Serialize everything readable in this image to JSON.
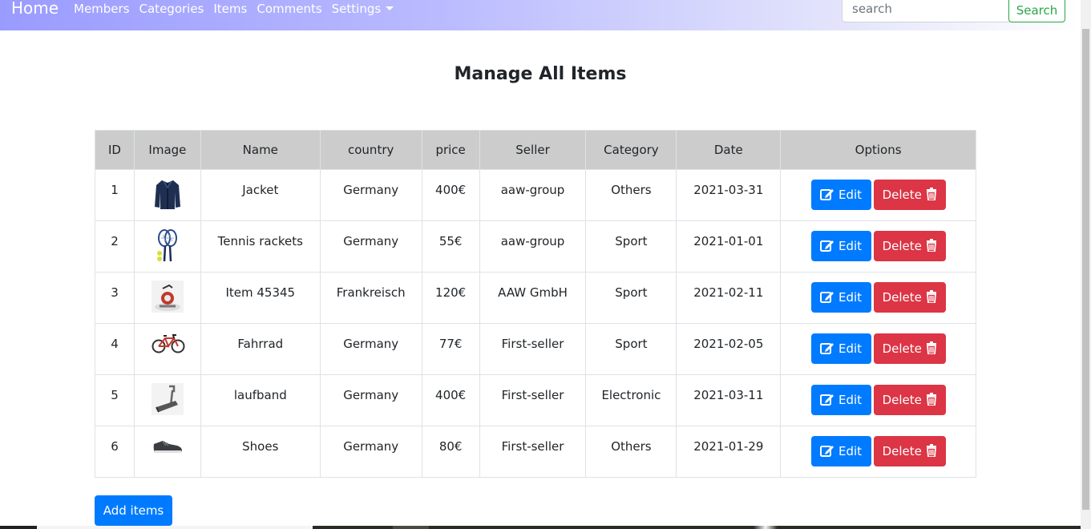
{
  "nav": {
    "brand": "Home",
    "links": [
      "Members",
      "Categories",
      "Items",
      "Comments",
      "Settings"
    ],
    "search_placeholder": "search",
    "search_button": "Search"
  },
  "page_title": "Manage All Items",
  "table": {
    "headers": [
      "ID",
      "Image",
      "Name",
      "country",
      "price",
      "Seller",
      "Category",
      "Date",
      "Options"
    ],
    "rows": [
      {
        "id": "1",
        "image": "jacket",
        "name": "Jacket",
        "country": "Germany",
        "price": "400€",
        "seller": "aaw-group",
        "category": "Others",
        "date": "2021-03-31"
      },
      {
        "id": "2",
        "image": "tennis-rackets",
        "name": "Tennis rackets",
        "country": "Germany",
        "price": "55€",
        "seller": "aaw-group",
        "category": "Sport",
        "date": "2021-01-01"
      },
      {
        "id": "3",
        "image": "exercise-bike",
        "name": "Item 45345",
        "country": "Frankreisch",
        "price": "120€",
        "seller": "AAW GmbH",
        "category": "Sport",
        "date": "2021-02-11"
      },
      {
        "id": "4",
        "image": "bicycle",
        "name": "Fahrrad",
        "country": "Germany",
        "price": "77€",
        "seller": "First-seller",
        "category": "Sport",
        "date": "2021-02-05"
      },
      {
        "id": "5",
        "image": "treadmill",
        "name": "laufband",
        "country": "Germany",
        "price": "400€",
        "seller": "First-seller",
        "category": "Electronic",
        "date": "2021-03-11"
      },
      {
        "id": "6",
        "image": "shoe",
        "name": "Shoes",
        "country": "Germany",
        "price": "80€",
        "seller": "First-seller",
        "category": "Others",
        "date": "2021-01-29"
      }
    ],
    "edit_label": "Edit",
    "delete_label": "Delete"
  },
  "add_button": "Add items",
  "colors": {
    "primary": "#007bff",
    "danger": "#dc3545",
    "success": "#28a745",
    "header_bg": "#cccccc"
  }
}
